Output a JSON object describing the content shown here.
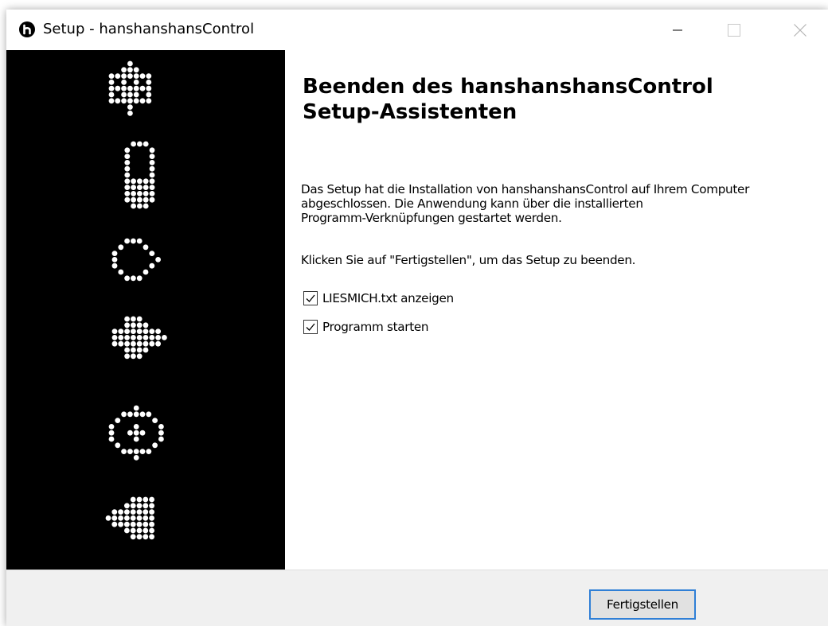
{
  "window": {
    "title": "Setup - hanshanshansControl",
    "minimize_icon": "minimize-icon",
    "maximize_icon": "maximize-icon",
    "close_icon": "close-icon"
  },
  "sidebar": {
    "image": "decorative dot-matrix icons column"
  },
  "content": {
    "heading_line1": "Beenden des hanshanshansControl",
    "heading_line2": "Setup-Assistenten",
    "description_lines": [
      "Das Setup hat die Installation von hanshanshansControl auf Ihrem Computer",
      "abgeschlossen. Die Anwendung kann über die installierten",
      "Programm-Verknüpfungen gestartet werden."
    ],
    "instruction": "Klicken Sie auf \"Fertigstellen\", um das Setup zu beenden.",
    "options": [
      {
        "label": "LIESMICH.txt anzeigen",
        "checked": true
      },
      {
        "label": "Programm starten",
        "checked": true
      }
    ]
  },
  "footer": {
    "finish_label": "Fertigstellen"
  },
  "colors": {
    "sidebar_bg": "#000000",
    "footer_bg": "#f0f0f0",
    "button_border": "#2f7fd6"
  }
}
